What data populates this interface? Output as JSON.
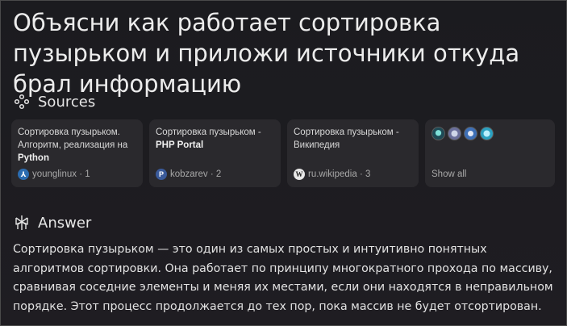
{
  "question": "Объясни как работает сортировка пузырьком и приложи источники откуда брал информацию",
  "sources": {
    "heading": "Sources",
    "cards": [
      {
        "title_plain": "Сортировка пузырьком. Алгоритм, реализация на ",
        "title_bold": "Python",
        "domain": "younglinux",
        "index": "· 1",
        "icon": "younglinux-favicon"
      },
      {
        "title_plain": "Сортировка пузырьком - ",
        "title_bold": "PHP Portal",
        "domain": "kobzarev",
        "index": "· 2",
        "icon": "kobzarev-favicon"
      },
      {
        "title_plain": "Сортировка пузырьком - Википедия",
        "title_bold": "",
        "domain": "ru.wikipedia",
        "index": "· 3",
        "icon": "wikipedia-favicon"
      }
    ],
    "show_all_label": "Show all"
  },
  "answer": {
    "heading": "Answer",
    "text": "Сортировка пузырьком — это один из самых простых и интуитивно понятных алгоритмов сортировки. Она работает по принципу многократного прохода по массиву, сравнивая соседние элементы и меняя их местами, если они находятся в неправильном порядке. Этот процесс продолжается до тех пор, пока массив не будет отсортирован."
  }
}
